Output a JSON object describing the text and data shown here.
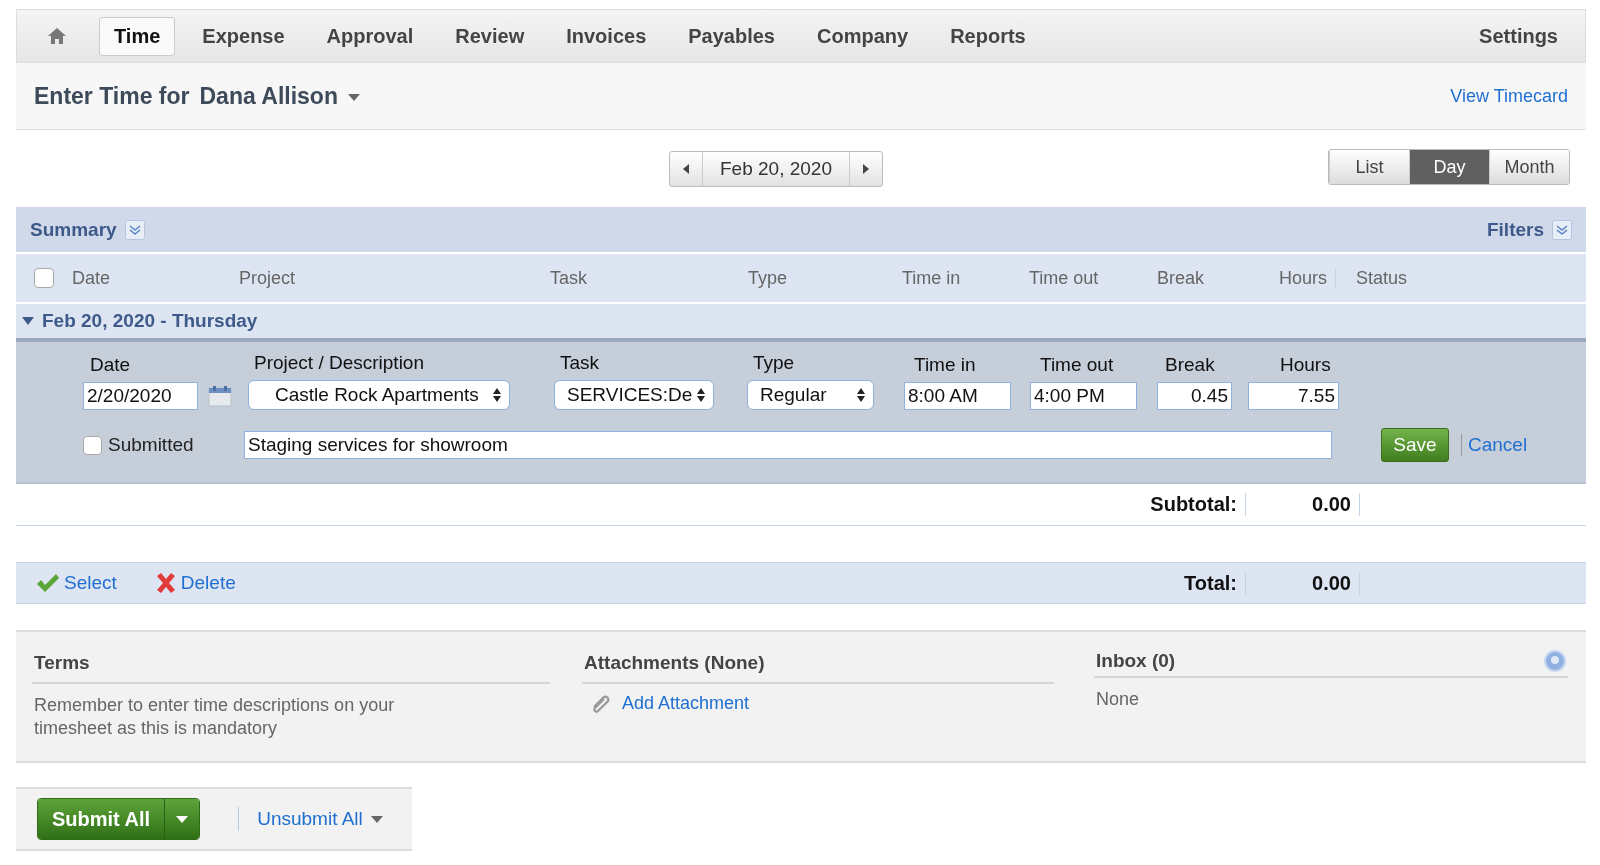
{
  "nav": {
    "tabs": [
      {
        "label": "Time",
        "selected": true
      },
      {
        "label": "Expense",
        "selected": false
      },
      {
        "label": "Approval",
        "selected": false
      },
      {
        "label": "Review",
        "selected": false
      },
      {
        "label": "Invoices",
        "selected": false
      },
      {
        "label": "Payables",
        "selected": false
      },
      {
        "label": "Company",
        "selected": false
      },
      {
        "label": "Reports",
        "selected": false
      }
    ],
    "settings": "Settings"
  },
  "header": {
    "prefix": "Enter Time for",
    "employee": "Dana Allison",
    "link": "View Timecard"
  },
  "date_nav": {
    "date": "Feb 20, 2020"
  },
  "views": [
    {
      "label": "List",
      "selected": false
    },
    {
      "label": "Day",
      "selected": true
    },
    {
      "label": "Month",
      "selected": false
    }
  ],
  "summary": {
    "title": "Summary",
    "filters": "Filters"
  },
  "select_all": {
    "checked": false
  },
  "columns": [
    "Date",
    "Project",
    "Task",
    "Type",
    "Time in",
    "Time out",
    "Break",
    "Hours",
    "Status"
  ],
  "group": {
    "title": "Feb 20, 2020 - Thursday",
    "expanded": true
  },
  "entry": {
    "labels": [
      "Date",
      "Project / Description",
      "Task",
      "Type",
      "Time in",
      "Time out",
      "Break",
      "Hours"
    ],
    "date": "2/20/2020",
    "project": "Castle Rock Apartments",
    "task": "SERVICES:De",
    "type": "Regular",
    "time_in": "8:00 AM",
    "time_out": "4:00 PM",
    "break": "0.45",
    "hours": "7.55",
    "submitted": {
      "label": "Submitted",
      "checked": false
    },
    "description": "Staging services for showroom",
    "save": "Save",
    "cancel": "Cancel"
  },
  "subtotal": {
    "label": "Subtotal:",
    "value": "0.00"
  },
  "actions": [
    {
      "label": "Select",
      "kind": "check"
    },
    {
      "label": "Delete",
      "kind": "delete"
    }
  ],
  "total": {
    "label": "Total:",
    "value": "0.00"
  },
  "terms": {
    "title": "Terms",
    "text": "Remember to enter time descriptions on your timesheet as this is mandatory"
  },
  "attachments": {
    "title": "Attachments (None)",
    "link": "Add Attachment"
  },
  "inbox": {
    "title": "Inbox (0)",
    "text": "None"
  },
  "footer": {
    "submit": "Submit All",
    "unsubmit": "Unsubmit All"
  }
}
